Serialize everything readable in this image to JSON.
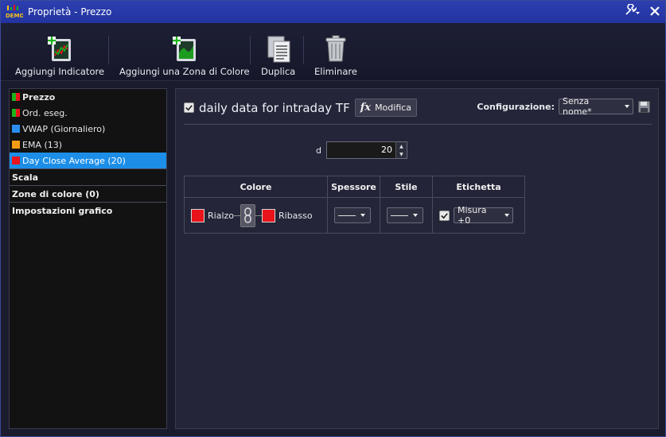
{
  "window": {
    "title": "Proprietà - Prezzo",
    "logo_text": "DEMO"
  },
  "toolbar": {
    "add_indicator": "Aggiungi Indicatore",
    "add_color_zone": "Aggiungi una Zona di Colore",
    "duplicate": "Duplica",
    "delete": "Eliminare"
  },
  "sidebar": {
    "items": [
      {
        "label": "Prezzo",
        "colors": [
          "#1bb51b",
          "#e8131b"
        ],
        "bold": true,
        "selected": false
      },
      {
        "label": "Ord. eseg.",
        "colors": [
          "#1bb51b",
          "#e8131b"
        ],
        "bold": false,
        "selected": false
      },
      {
        "label": "VWAP (Giornaliero)",
        "colors": [
          "#2a8ef0"
        ],
        "bold": false,
        "selected": false
      },
      {
        "label": "EMA (13)",
        "colors": [
          "#f39a14"
        ],
        "bold": false,
        "selected": false
      },
      {
        "label": "Day Close Average (20)",
        "colors": [
          "#e8131b"
        ],
        "bold": false,
        "selected": true
      }
    ],
    "sections": [
      "Scala",
      "Zone di colore (0)",
      "Impostazioni grafico"
    ]
  },
  "panel": {
    "indicator_name": "daily data for intraday TF",
    "enabled": true,
    "modify_label": "Modifica",
    "modify_icon_text": "fx",
    "config_label": "Configurazione:",
    "config_value": "Senza nome*",
    "param_label": "d",
    "param_value": "20"
  },
  "table": {
    "headers": [
      "Colore",
      "Spessore",
      "Stile",
      "Etichetta"
    ],
    "up_label": "Rialzo",
    "down_label": "Ribasso",
    "up_color": "#e8131b",
    "down_color": "#e8131b",
    "label_enabled": true,
    "label_value": "Misura +0"
  }
}
